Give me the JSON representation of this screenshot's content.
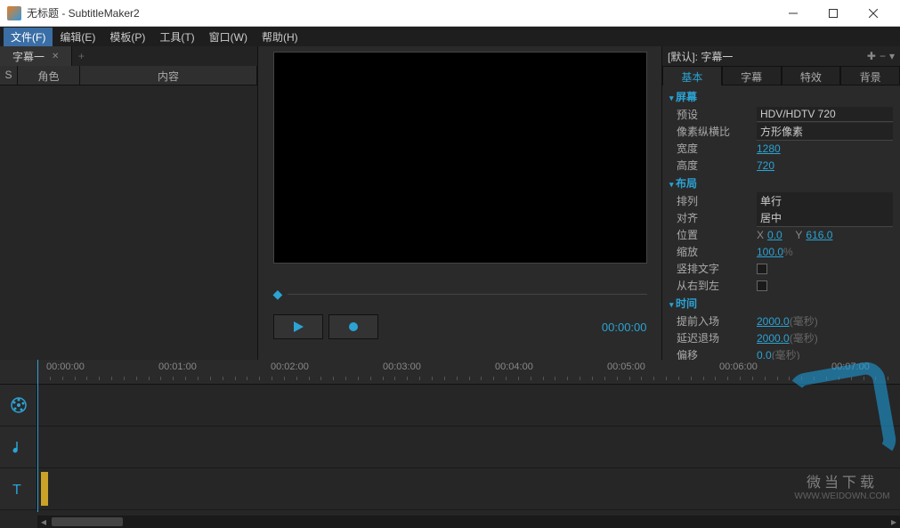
{
  "title": "无标题 - SubtitleMaker2",
  "menu": {
    "file": "文件(F)",
    "edit": "编辑(E)",
    "template": "模板(P)",
    "tools": "工具(T)",
    "window": "窗口(W)",
    "help": "帮助(H)"
  },
  "left": {
    "tab": "字幕一",
    "col_s": "S",
    "col_role": "角色",
    "col_content": "内容"
  },
  "player": {
    "timecode": "00:00:00"
  },
  "right": {
    "title": "[默认]: 字幕一",
    "tabs": {
      "basic": "基本",
      "subtitle": "字幕",
      "fx": "特效",
      "bg": "背景"
    },
    "screen": {
      "header": "屏幕",
      "preset_label": "预设",
      "preset_value": "HDV/HDTV 720",
      "par_label": "像素纵横比",
      "par_value": "方形像素",
      "width_label": "宽度",
      "width_value": "1280",
      "height_label": "高度",
      "height_value": "720"
    },
    "layout": {
      "header": "布局",
      "arrange_label": "排列",
      "arrange_value": "单行",
      "align_label": "对齐",
      "align_value": "居中",
      "pos_label": "位置",
      "pos_x_label": "X",
      "pos_x": "0.0",
      "pos_y_label": "Y",
      "pos_y": "616.0",
      "scale_label": "缩放",
      "scale_value": "100.0",
      "scale_unit": "%",
      "vertical_label": "竖排文字",
      "rtl_label": "从右到左"
    },
    "time": {
      "header": "时间",
      "prein_label": "提前入场",
      "prein_value": "2000.0",
      "prein_unit": "(毫秒)",
      "delayout_label": "延迟退场",
      "delayout_value": "2000.0",
      "delayout_unit": "(毫秒)",
      "offset_label": "偏移",
      "offset_value": "0.0",
      "offset_unit": "(毫秒)"
    }
  },
  "timeline": {
    "ticks": [
      "00:00:00",
      "00:01:00",
      "00:02:00",
      "00:03:00",
      "00:04:00",
      "00:05:00",
      "00:06:00",
      "00:07:00"
    ]
  },
  "watermark": {
    "t1": "微当下载",
    "t2": "WWW.WEIDOWN.COM"
  }
}
